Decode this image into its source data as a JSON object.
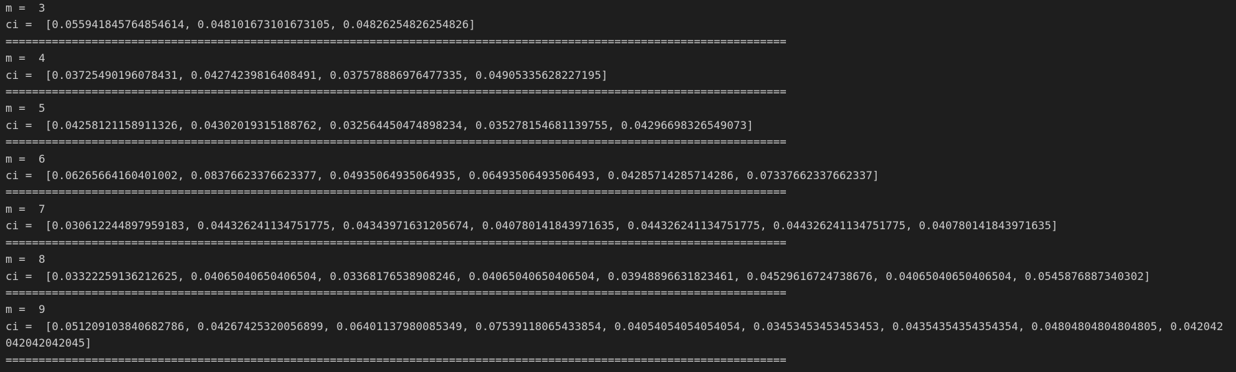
{
  "terminal": {
    "lines": [
      "m =  3",
      "ci =  [0.055941845764854614, 0.048101673101673105, 0.04826254826254826]",
      "======================================================================================================================",
      "m =  4",
      "ci =  [0.03725490196078431, 0.04274239816408491, 0.037578886976477335, 0.04905335628227195]",
      "======================================================================================================================",
      "m =  5",
      "ci =  [0.04258121158911326, 0.04302019315188762, 0.032564450474898234, 0.035278154681139755, 0.04296698326549073]",
      "======================================================================================================================",
      "m =  6",
      "ci =  [0.06265664160401002, 0.08376623376623377, 0.04935064935064935, 0.06493506493506493, 0.04285714285714286, 0.07337662337662337]",
      "======================================================================================================================",
      "m =  7",
      "ci =  [0.030612244897959183, 0.044326241134751775, 0.04343971631205674, 0.040780141843971635, 0.044326241134751775, 0.044326241134751775, 0.040780141843971635]",
      "======================================================================================================================",
      "m =  8",
      "ci =  [0.03322259136212625, 0.04065040650406504, 0.03368176538908246, 0.04065040650406504, 0.03948896631823461, 0.04529616724738676, 0.04065040650406504, 0.0545876887340302]",
      "======================================================================================================================",
      "m =  9",
      "ci =  [0.05120910384068278​6, 0.04267425320056899, 0.0640113798008534​9, 0.07539118065433854, 0.04054054054054054, 0.03453453453453453, 0.04354354354354354, 0.04804804804804805, 0.042042042042042045]",
      "======================================================================================================================"
    ]
  }
}
